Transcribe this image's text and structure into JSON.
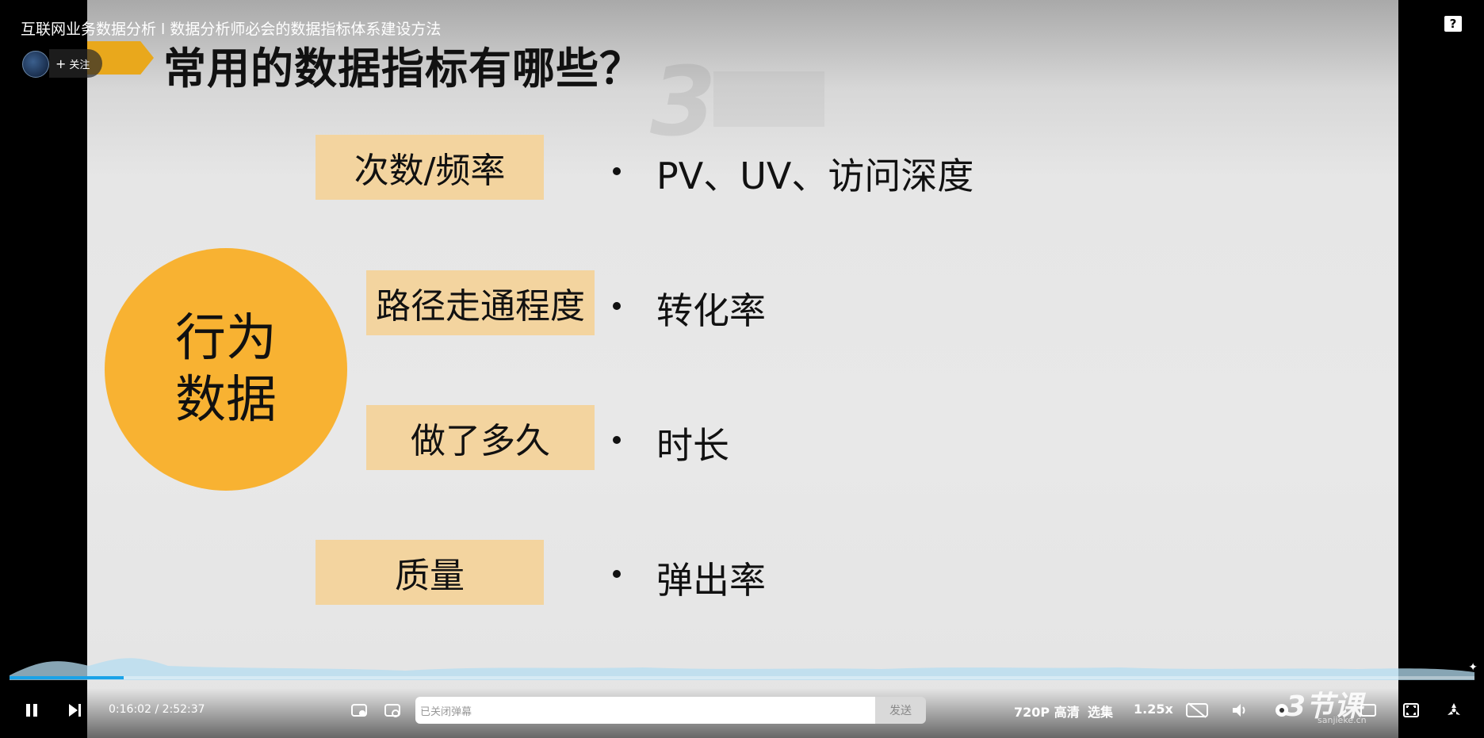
{
  "video": {
    "title": "互联网业务数据分析 l 数据分析师必会的数据指标体系建设方法",
    "follow_label": "关注",
    "help_icon": "help-icon"
  },
  "slide": {
    "heading": "常用的数据指标有哪些？",
    "circle_label": "行为数据",
    "items": [
      {
        "category": "次数/频率",
        "detail": "PV、UV、访问深度"
      },
      {
        "category": "路径走通程度",
        "detail": "转化率"
      },
      {
        "category": "做了多久",
        "detail": "时长"
      },
      {
        "category": "质量",
        "detail": "弹出率"
      }
    ],
    "accent_color": "#f8b232",
    "box_color": "#f3d49f"
  },
  "player": {
    "current_time": "0:16:02",
    "separator": "/",
    "duration": "2:52:37",
    "progress_fraction": 0.078,
    "danmaku_placeholder": "已关闭弹幕",
    "send_label": "发送",
    "quality_label": "720P 高清",
    "episodes_label": "选集",
    "speed_label": "1.25x",
    "brand_logo": "3节课",
    "brand_site": "sanjieke.cn",
    "accent_color": "#1aa3e8"
  }
}
